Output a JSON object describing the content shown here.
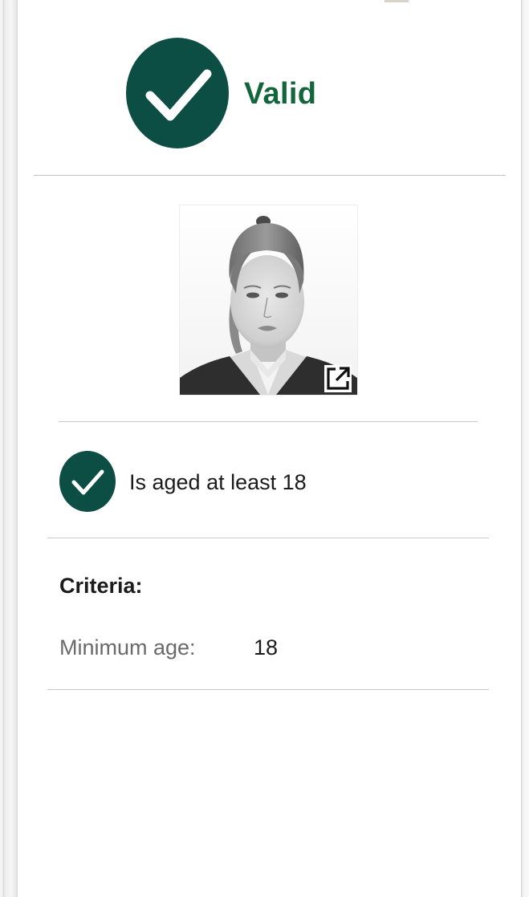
{
  "result": {
    "status_label": "Valid",
    "status_color": "#13663c",
    "badge_color": "#0c4e44",
    "badge_icon": "checkmark-icon"
  },
  "photo": {
    "alt": "Identity photo",
    "open_icon": "open-in-new-icon"
  },
  "checks": [
    {
      "label": "Is aged at least 18",
      "passed": true,
      "icon": "checkmark-icon"
    }
  ],
  "criteria": {
    "heading": "Criteria:",
    "items": [
      {
        "label": "Minimum age:",
        "value": "18"
      }
    ]
  }
}
